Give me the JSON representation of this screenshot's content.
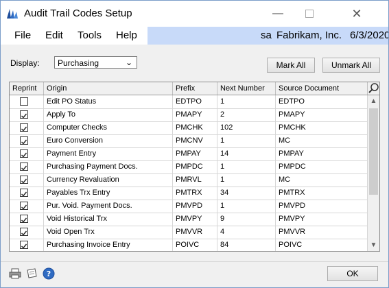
{
  "window": {
    "title": "Audit Trail Codes Setup"
  },
  "menu": [
    "File",
    "Edit",
    "Tools",
    "Help"
  ],
  "banner": {
    "user": "sa",
    "company": "Fabrikam, Inc.",
    "date": "6/3/2020"
  },
  "display": {
    "label": "Display:",
    "value": "Purchasing"
  },
  "buttons": {
    "mark_all": "Mark All",
    "unmark_all": "Unmark All",
    "ok": "OK"
  },
  "table": {
    "headers": [
      "Reprint",
      "Origin",
      "Prefix",
      "Next Number",
      "Source Document"
    ],
    "rows": [
      {
        "checked": false,
        "origin": "Edit PO Status",
        "prefix": "EDTPO",
        "next": "1",
        "source": "EDTPO"
      },
      {
        "checked": true,
        "origin": "Apply To",
        "prefix": "PMAPY",
        "next": "2",
        "source": "PMAPY"
      },
      {
        "checked": true,
        "origin": "Computer Checks",
        "prefix": "PMCHK",
        "next": "102",
        "source": "PMCHK"
      },
      {
        "checked": true,
        "origin": "Euro Conversion",
        "prefix": "PMCNV",
        "next": "1",
        "source": "MC"
      },
      {
        "checked": true,
        "origin": "Payment Entry",
        "prefix": "PMPAY",
        "next": "14",
        "source": "PMPAY"
      },
      {
        "checked": true,
        "origin": "Purchasing Payment Docs.",
        "prefix": "PMPDC",
        "next": "1",
        "source": "PMPDC"
      },
      {
        "checked": true,
        "origin": "Currency Revaluation",
        "prefix": "PMRVL",
        "next": "1",
        "source": "MC"
      },
      {
        "checked": true,
        "origin": "Payables Trx Entry",
        "prefix": "PMTRX",
        "next": "34",
        "source": "PMTRX"
      },
      {
        "checked": true,
        "origin": "Pur. Void. Payment Docs.",
        "prefix": "PMVPD",
        "next": "1",
        "source": "PMVPD"
      },
      {
        "checked": true,
        "origin": "Void Historical Trx",
        "prefix": "PMVPY",
        "next": "9",
        "source": "PMVPY"
      },
      {
        "checked": true,
        "origin": "Void Open Trx",
        "prefix": "PMVVR",
        "next": "4",
        "source": "PMVVR"
      },
      {
        "checked": true,
        "origin": "Purchasing Invoice Entry",
        "prefix": "POIVC",
        "next": "84",
        "source": "POIVC"
      }
    ]
  },
  "icons": {
    "app": "dynamics-gp-logo-icon",
    "zoom": "magnifier-icon",
    "print": "printer-icon",
    "notes": "note-icon",
    "help": "help-icon"
  },
  "colors": {
    "banner": "#c8daf9",
    "window_border": "#7a9cc8"
  }
}
